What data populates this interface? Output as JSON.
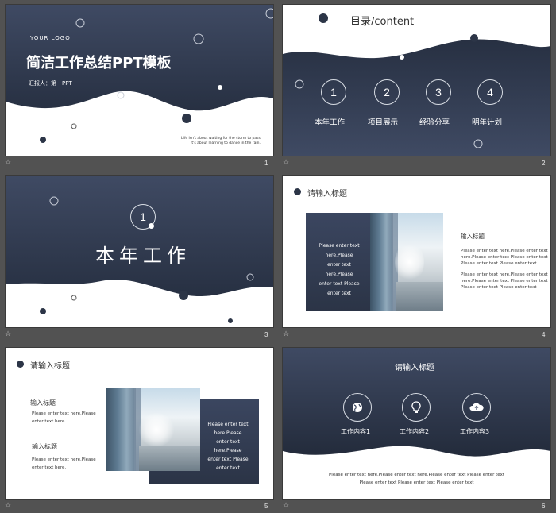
{
  "slides": [
    {
      "number": "1",
      "logo": "YOUR LOGO",
      "title": "简洁工作总结PPT模板",
      "reporter": "汇报人：第一PPT",
      "tagline1": "Life isn't about waiting for the storm to pass.",
      "tagline2": "It's about learning to dance in the rain."
    },
    {
      "number": "2",
      "title": "目录/content",
      "items": [
        {
          "num": "1",
          "label": "本年工作"
        },
        {
          "num": "2",
          "label": "项目展示"
        },
        {
          "num": "3",
          "label": "经验分享"
        },
        {
          "num": "4",
          "label": "明年计划"
        }
      ]
    },
    {
      "number": "3",
      "section_num": "1",
      "section_title": "本年工作"
    },
    {
      "number": "4",
      "title": "请输入标题",
      "box_text": [
        "Please enter text",
        "here.Please",
        "enter text",
        "here.Please",
        "enter text Please",
        "enter text"
      ],
      "subtitle": "输入标题",
      "para1": [
        "Please enter text here.Please enter text",
        "here.Please enter text Please enter text",
        "Please enter text Please enter text"
      ],
      "para2": [
        "Please enter text here.Please enter text",
        "here.Please enter text Please enter text",
        "Please enter text Please enter text"
      ]
    },
    {
      "number": "5",
      "title": "请输入标题",
      "sub1": "输入标题",
      "sub1_text": [
        "Please enter text here.Please",
        "enter text here."
      ],
      "sub2": "输入标题",
      "sub2_text": [
        "Please enter text here.Please",
        "enter text here."
      ],
      "box_text": [
        "Please enter text",
        "here.Please",
        "enter text",
        "here.Please",
        "enter text Please",
        "enter text"
      ]
    },
    {
      "number": "6",
      "title": "请输入标题",
      "items": [
        {
          "icon": "globe-icon",
          "label": "工作内容1"
        },
        {
          "icon": "lightbulb-icon",
          "label": "工作内容2"
        },
        {
          "icon": "cloud-upload-icon",
          "label": "工作内容3"
        }
      ],
      "footer1": "Please enter text here.Please enter text here.Please enter text Please enter text",
      "footer2": "Please enter text Please enter text Please enter text"
    }
  ],
  "colors": {
    "dark": "#2c3547",
    "dark_top": "#3f4a63",
    "background": "#525252"
  },
  "star_icon": "star-icon"
}
